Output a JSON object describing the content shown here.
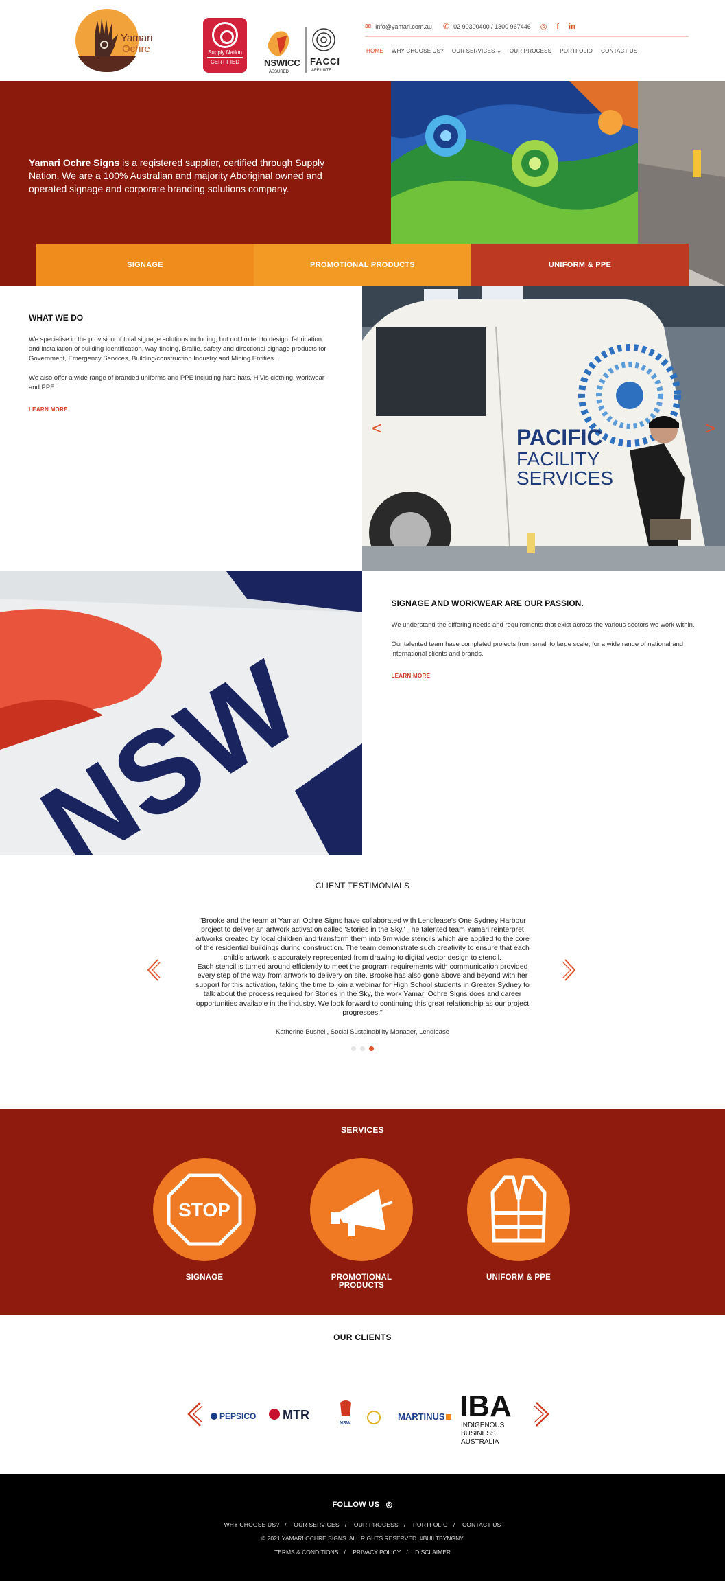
{
  "header": {
    "logo_text_line1": "Yamari",
    "logo_text_line2": "Ochre",
    "supply_nation_line1": "Supply Nation",
    "supply_nation_line2": "CERTIFIED",
    "nswicc_text": "NSWICC",
    "nswicc_sub": "ASSURED",
    "facci_text": "FACCI",
    "facci_sub": "AFFILIATE",
    "email": "info@yamari.com.au",
    "phone": "02 90300400 /  1300 967446",
    "nav": [
      {
        "label": "HOME",
        "active": true
      },
      {
        "label": "WHY CHOOSE US?",
        "active": false
      },
      {
        "label": "OUR SERVICES",
        "active": false
      },
      {
        "label": "OUR PROCESS",
        "active": false
      },
      {
        "label": "PORTFOLIO",
        "active": false
      },
      {
        "label": "CONTACT US",
        "active": false
      }
    ]
  },
  "hero": {
    "brand": "Yamari Ochre Signs",
    "text": " is a registered supplier, certified through Supply Nation. We are a 100% Australian and majority Aboriginal owned and operated signage and corporate branding solutions company.",
    "tabs": [
      "SIGNAGE",
      "PROMOTIONAL PRODUCTS",
      "UNIFORM & PPE"
    ]
  },
  "what_we_do": {
    "title": "WHAT WE DO",
    "p1": "We specialise in the provision of total signage solutions including, but not limited to design, fabrication and installation of building identification, way-finding, Braille, safety and directional signage products for Government, Emergency Services, Building/construction Industry and Mining Entities.",
    "p2": "We also offer a wide range of branded uniforms and PPE including hard hats, HiVis clothing, workwear and PPE.",
    "learn_more": "LEARN MORE",
    "van_line1": "PACIFIC",
    "van_line2": "FACILITY",
    "van_line3": "SERVICES"
  },
  "passion": {
    "title": "SIGNAGE AND WORKWEAR ARE OUR PASSION.",
    "p1": "We understand the differing needs and requirements that exist across the various sectors we work within.",
    "p2": "Our talented team have completed projects from small to large scale, for a wide range of national and international clients and brands.",
    "learn_more": "LEARN MORE",
    "sign_text": "NSW"
  },
  "testimonials": {
    "title": "CLIENT TESTIMONIALS",
    "quote": "\"Brooke and the team at Yamari Ochre Signs have collaborated with Lendlease's One Sydney Harbour project to deliver an artwork activation called 'Stories in the Sky.' The talented team Yamari reinterpret artworks created by local children and transform them into 6m wide stencils which are applied to the core of the residential buildings during construction. The team demonstrate such creativity to ensure that each child's artwork is accurately represented from drawing to digital vector design to stencil.",
    "quote2": "Each stencil is turned around efficiently to meet the program requirements with communication provided every step of the way from artwork to delivery on site. Brooke has also gone above and beyond with her support for this activation, taking the time to join a webinar for High School students in Greater Sydney to talk about the process required for Stories in the Sky, the work Yamari Ochre Signs does and career opportunities available in the industry. We look forward to continuing this great relationship as our project progresses.\"",
    "author": "Katherine Bushell, Social Sustainability Manager, Lendlease",
    "active_dot": 2
  },
  "services": {
    "title": "SERVICES",
    "items": [
      {
        "label": "SIGNAGE",
        "icon": "stop-sign-icon",
        "icon_text": "STOP"
      },
      {
        "label": "PROMOTIONAL PRODUCTS",
        "icon": "megaphone-icon"
      },
      {
        "label": "UNIFORM & PPE",
        "icon": "hi-vis-vest-icon"
      }
    ]
  },
  "clients": {
    "title": "OUR CLIENTS",
    "logos": [
      "PEPSICO",
      "MTR",
      "NSW",
      "MARTINUS",
      "IBA"
    ],
    "iba_sub1": "INDIGENOUS",
    "iba_sub2": "BUSINESS",
    "iba_sub3": "AUSTRALIA"
  },
  "footer": {
    "follow": "FOLLOW US",
    "links": [
      "WHY CHOOSE US?",
      "OUR SERVICES",
      "OUR PROCESS",
      "PORTFOLIO",
      "CONTACT US"
    ],
    "copyright": "2021 YAMARI OCHRE SIGNS. ALL RIGHTS RESERVED. #BUILTBYNGNY",
    "legal": [
      "TERMS & CONDITIONS",
      "PRIVACY POLICY",
      "DISCLAIMER"
    ]
  },
  "colors": {
    "accent": "#e2522b",
    "hero_bg": "#8b1a0d",
    "orange": "#f07a23",
    "footer_bg": "#000000"
  }
}
